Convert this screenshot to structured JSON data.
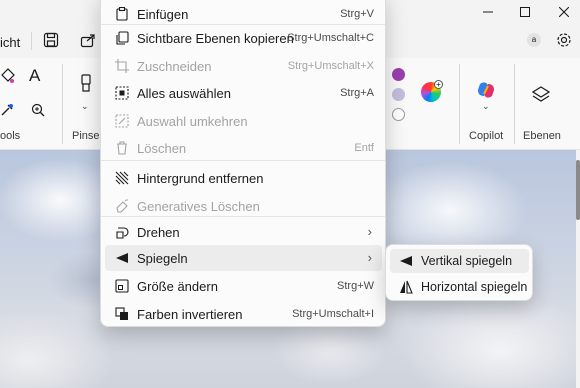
{
  "window": {
    "minimize_icon": "minimize-icon",
    "maximize_icon": "maximize-icon",
    "close_icon": "close-icon"
  },
  "menubar": {
    "partial_label": "icht",
    "account_initial": "a"
  },
  "ribbon": {
    "groups": {
      "tools": "ools",
      "brushes": "Pinsel",
      "copilot": "Copilot",
      "layers": "Ebenen"
    },
    "colors": {
      "purple": "#9b3fae",
      "lavender": "#c3bedc",
      "white": "#ffffff"
    }
  },
  "context_menu": {
    "items": [
      {
        "label": "Einfügen",
        "shortcut": "Strg+V",
        "icon": "paste-icon",
        "enabled": true
      },
      {
        "label": "Sichtbare Ebenen kopieren",
        "shortcut": "Strg+Umschalt+C",
        "icon": "copy-layers-icon",
        "enabled": true
      },
      {
        "label": "Zuschneiden",
        "shortcut": "Strg+Umschalt+X",
        "icon": "crop-icon",
        "enabled": false
      },
      {
        "label": "Alles auswählen",
        "shortcut": "Strg+A",
        "icon": "select-all-icon",
        "enabled": true
      },
      {
        "label": "Auswahl umkehren",
        "shortcut": "",
        "icon": "invert-selection-icon",
        "enabled": false
      },
      {
        "label": "Löschen",
        "shortcut": "Entf",
        "icon": "delete-icon",
        "enabled": false
      },
      {
        "label": "Hintergrund entfernen",
        "shortcut": "",
        "icon": "remove-background-icon",
        "enabled": true
      },
      {
        "label": "Generatives Löschen",
        "shortcut": "",
        "icon": "generative-erase-icon",
        "enabled": false
      },
      {
        "label": "Drehen",
        "shortcut": "",
        "icon": "rotate-icon",
        "enabled": true,
        "submenu": true
      },
      {
        "label": "Spiegeln",
        "shortcut": "",
        "icon": "flip-icon",
        "enabled": true,
        "submenu": true,
        "highlighted": true
      },
      {
        "label": "Größe ändern",
        "shortcut": "Strg+W",
        "icon": "resize-icon",
        "enabled": true
      },
      {
        "label": "Farben invertieren",
        "shortcut": "Strg+Umschalt+I",
        "icon": "invert-colors-icon",
        "enabled": true
      }
    ]
  },
  "submenu": {
    "items": [
      {
        "label": "Vertikal spiegeln",
        "icon": "flip-vertical-icon",
        "highlighted": true
      },
      {
        "label": "Horizontal spiegeln",
        "icon": "flip-horizontal-icon",
        "highlighted": false
      }
    ]
  }
}
